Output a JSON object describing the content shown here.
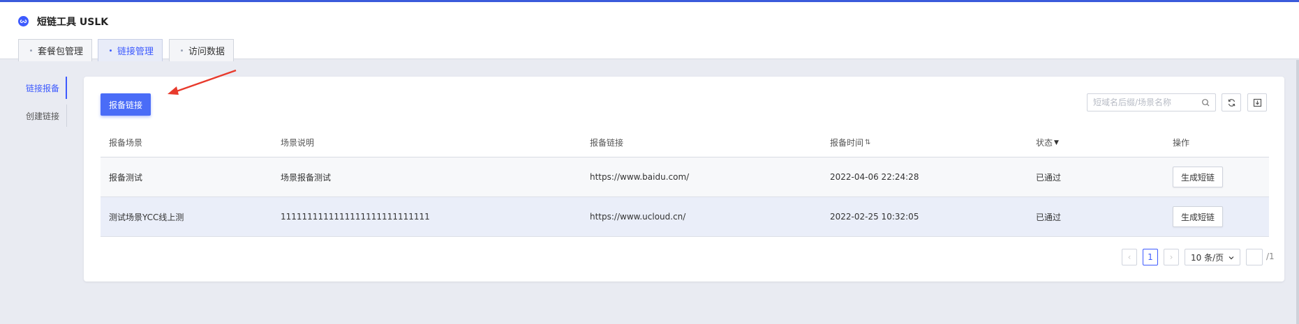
{
  "app": {
    "title": "短链工具 USLK",
    "logo_icon": "link-logo-icon",
    "accent": "#3d5afe"
  },
  "tabs": [
    {
      "label": "套餐包管理",
      "active": false
    },
    {
      "label": "链接管理",
      "active": true
    },
    {
      "label": "访问数据",
      "active": false
    }
  ],
  "sidebar": {
    "items": [
      {
        "label": "链接报备",
        "active": true
      },
      {
        "label": "创建链接",
        "active": false
      }
    ]
  },
  "toolbar": {
    "register_button": "报备链接",
    "search_placeholder": "短域名后缀/场景名称",
    "search_icon": "search-icon",
    "refresh_icon": "refresh-icon",
    "download_icon": "download-icon"
  },
  "table": {
    "headers": [
      "报备场景",
      "场景说明",
      "报备链接",
      "报备时间",
      "状态",
      "操作"
    ],
    "sort_icon": "⇅",
    "filter_icon": "▼",
    "rows": [
      {
        "scene": "报备测试",
        "desc": "场景报备测试",
        "url": "https://www.baidu.com/",
        "time": "2022-04-06 22:24:28",
        "status": "已通过",
        "action": "生成短链"
      },
      {
        "scene": "测试场景YCC线上测",
        "desc": "1111111111111111111111111111",
        "url": "https://www.ucloud.cn/",
        "time": "2022-02-25 10:32:05",
        "status": "已通过",
        "action": "生成短链"
      }
    ]
  },
  "pagination": {
    "prev": "‹",
    "current_page": "1",
    "next": "›",
    "page_size": "10 条/页",
    "jump_value": "",
    "total_pages": "/1"
  }
}
